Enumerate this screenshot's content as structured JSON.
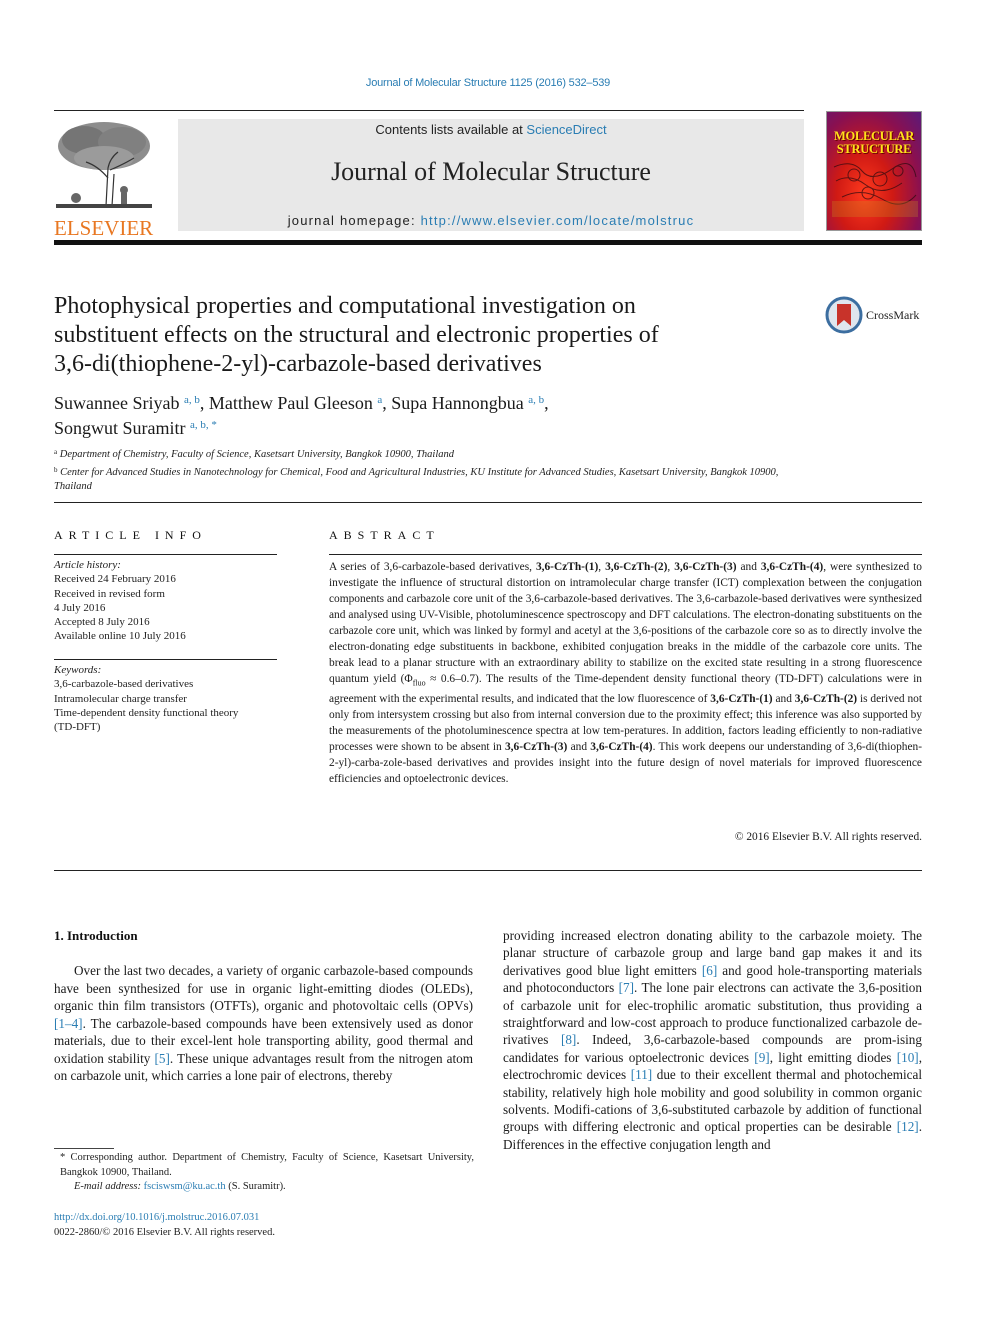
{
  "running_head": "Journal of Molecular Structure 1125 (2016) 532–539",
  "banner": {
    "contents_prefix": "Contents lists available at ",
    "contents_link": "ScienceDirect",
    "journal_name": "Journal of Molecular Structure",
    "homepage_prefix": "journal homepage: ",
    "homepage_link": "http://www.elsevier.com/locate/molstruc"
  },
  "publisher_logo": {
    "wordmark": "ELSEVIER",
    "icon": "elsevier-tree-icon",
    "color": "#e87722"
  },
  "cover": {
    "title_line1": "MOLECULAR",
    "title_line2": "STRUCTURE"
  },
  "crossmark": {
    "label": "CrossMark",
    "icon": "crossmark-icon"
  },
  "article": {
    "title_lines": [
      "Photophysical properties and computational investigation on",
      "substituent effects on the structural and electronic properties of",
      "3,6-di(thiophene-2-yl)-carbazole-based derivatives"
    ],
    "authors": [
      {
        "name": "Suwannee Sriyab",
        "sup": "a, b",
        "sep": ", "
      },
      {
        "name": "Matthew Paul Gleeson",
        "sup": "a",
        "sep": ", "
      },
      {
        "name": "Supa Hannongbua",
        "sup": "a, b",
        "sep": ","
      },
      {
        "name": "Songwut Suramitr",
        "sup": "a, b, *",
        "sep": ""
      }
    ],
    "affiliations": [
      {
        "mark": "a",
        "text": "Department of Chemistry, Faculty of Science, Kasetsart University, Bangkok 10900, Thailand"
      },
      {
        "mark": "b",
        "text": "Center for Advanced Studies in Nanotechnology for Chemical, Food and Agricultural Industries, KU Institute for Advanced Studies, Kasetsart University, Bangkok 10900, Thailand"
      }
    ]
  },
  "article_info": {
    "heading": "ARTICLE INFO",
    "history_label": "Article history:",
    "history": [
      "Received 24 February 2016",
      "Received in revised form",
      "4 July 2016",
      "Accepted 8 July 2016",
      "Available online 10 July 2016"
    ],
    "keywords_label": "Keywords:",
    "keywords": [
      "3,6-carbazole-based derivatives",
      "Intramolecular charge transfer",
      "Time-dependent density functional theory",
      "(TD-DFT)"
    ]
  },
  "abstract": {
    "heading": "ABSTRACT",
    "segments": [
      {
        "t": "A series of 3,6-carbazole-based derivatives, "
      },
      {
        "t": "3,6-CzTh-(1)",
        "b": true
      },
      {
        "t": ", "
      },
      {
        "t": "3,6-CzTh-(2)",
        "b": true
      },
      {
        "t": ", "
      },
      {
        "t": "3,6-CzTh-(3)",
        "b": true
      },
      {
        "t": " and "
      },
      {
        "t": "3,6-CzTh-(4)",
        "b": true
      },
      {
        "t": ", were synthesized to investigate the influence of structural distortion on intramolecular charge transfer (ICT) complexation between the conjugation components and carbazole core unit of the 3,6-carbazole-based derivatives. The 3,6-carbazole-based derivatives were synthesized and analysed using UV-Visible, photoluminescence spectroscopy and DFT calculations. The electron-donating substituents on the carbazole core unit, which was linked by formyl and acetyl at the 3,6-positions of the carbazole core so as to directly involve the electron-donating edge substituents in backbone, exhibited conjugation breaks in the middle of the carbazole core units. The break lead to a planar structure with an extraordinary ability to stabilize on the excited state resulting in a strong fluorescence quantum yield (Φ"
      },
      {
        "t": "fluo",
        "sub": true
      },
      {
        "t": " ≈ 0.6–0.7). The results of the Time-dependent density functional theory (TD-DFT) calculations were in agreement with the experimental results, and indicated that the low fluorescence of "
      },
      {
        "t": "3,6-CzTh-(1)",
        "b": true
      },
      {
        "t": " and "
      },
      {
        "t": "3,6-CzTh-(2)",
        "b": true
      },
      {
        "t": " is derived not only from intersystem crossing but also from internal conversion due to the proximity effect; this inference was also supported by the measurements of the photoluminescence spectra at low tem-peratures. In addition, factors leading efficiently to non-radiative processes were shown to be absent in "
      },
      {
        "t": "3,6-CzTh-(3)",
        "b": true
      },
      {
        "t": " and "
      },
      {
        "t": "3,6-CzTh-(4)",
        "b": true
      },
      {
        "t": ". This work deepens our understanding of 3,6-di(thiophen-2-yl)-carba-zole-based derivatives and provides insight into the future design of novel materials for improved fluorescence efficiencies and optoelectronic devices."
      }
    ],
    "copyright": "© 2016 Elsevier B.V. All rights reserved."
  },
  "introduction": {
    "heading": "1.  Introduction",
    "left_segments": [
      {
        "t": "Over the last two decades, a variety of organic carbazole-based compounds have been synthesized for use in organic light-emitting diodes (OLEDs), organic thin film transistors (OTFTs), organic and photovoltaic cells (OPVs) "
      },
      {
        "t": "[1–4]",
        "ref": true
      },
      {
        "t": ". The carbazole-based compounds have been extensively used as donor materials, due to their excel-lent hole transporting ability, good thermal and oxidation stability "
      },
      {
        "t": "[5]",
        "ref": true
      },
      {
        "t": ". These unique advantages result from the nitrogen atom on carbazole unit, which carries a lone pair of electrons, thereby"
      }
    ],
    "right_segments": [
      {
        "t": "providing increased electron donating ability to the carbazole moiety. The planar structure of carbazole group and large band gap makes it and its derivatives good blue light emitters "
      },
      {
        "t": "[6]",
        "ref": true
      },
      {
        "t": " and good hole-transporting materials and photoconductors "
      },
      {
        "t": "[7]",
        "ref": true
      },
      {
        "t": ". The lone pair electrons can activate the 3,6-position of carbazole unit for elec-trophilic aromatic substitution, thus providing a straightforward and low-cost approach to produce functionalized carbazole de-rivatives "
      },
      {
        "t": "[8]",
        "ref": true
      },
      {
        "t": ". Indeed, 3,6-carbazole-based compounds are prom-ising candidates for various optoelectronic devices "
      },
      {
        "t": "[9]",
        "ref": true
      },
      {
        "t": ", light emitting diodes "
      },
      {
        "t": "[10]",
        "ref": true
      },
      {
        "t": ", electrochromic devices "
      },
      {
        "t": "[11]",
        "ref": true
      },
      {
        "t": " due to their excellent thermal and photochemical stability, relatively high hole mobility and good solubility in common organic solvents. Modifi-cations of 3,6-substituted carbazole by addition of functional groups with differing electronic and optical properties can be desirable "
      },
      {
        "t": "[12]",
        "ref": true
      },
      {
        "t": ". Differences in the effective conjugation length and"
      }
    ]
  },
  "footnote": {
    "corresponding": "* Corresponding author. Department of Chemistry, Faculty of Science, Kasetsart University, Bangkok 10900, Thailand.",
    "email_label": "E-mail address: ",
    "email": "fsciswsm@ku.ac.th",
    "email_suffix": " (S. Suramitr)."
  },
  "doi": {
    "link": "http://dx.doi.org/10.1016/j.molstruc.2016.07.031",
    "issn_line": "0022-2860/© 2016 Elsevier B.V. All rights reserved."
  }
}
